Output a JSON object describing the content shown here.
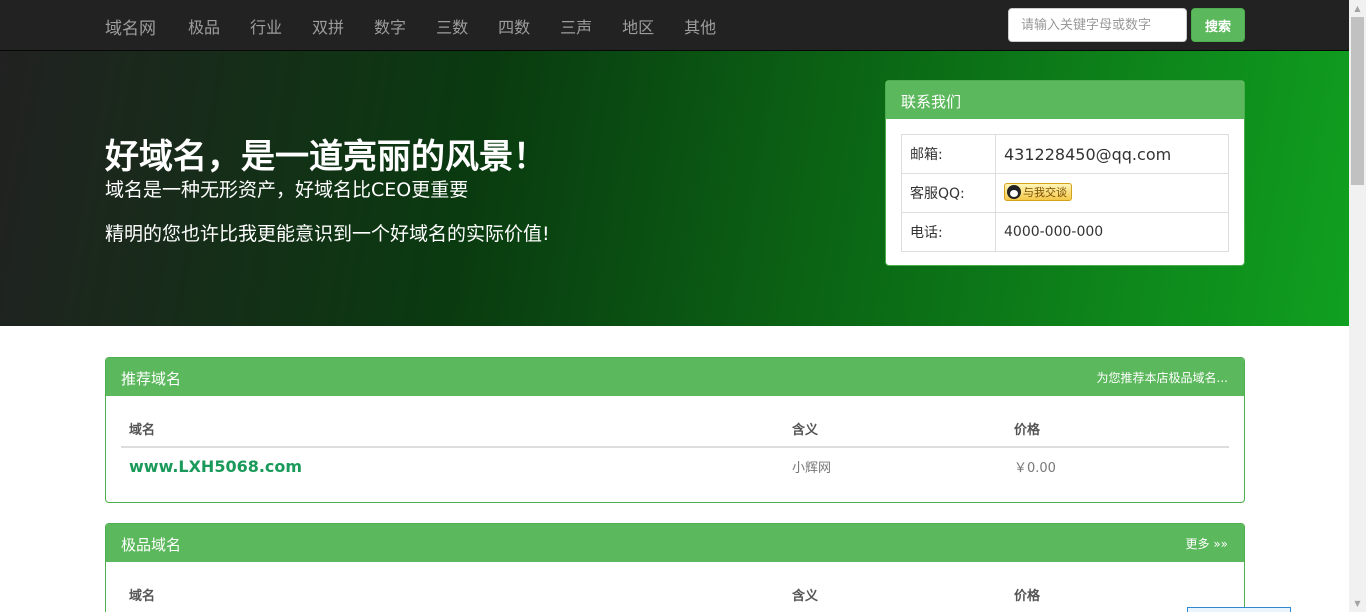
{
  "nav": {
    "brand": "域名网",
    "links": [
      "极品",
      "行业",
      "双拼",
      "数字",
      "三数",
      "四数",
      "三声",
      "地区",
      "其他"
    ],
    "search_placeholder": "请输入关键字母或数字",
    "search_button": "搜索"
  },
  "hero": {
    "title": "好域名，是一道亮丽的风景！",
    "subtitle": "域名是一种无形资产，好域名比CEO更重要",
    "line": "精明的您也许比我更能意识到一个好域名的实际价值!"
  },
  "contact": {
    "title": "联系我们",
    "rows": [
      {
        "label": "邮箱:",
        "value": "431228450@qq.com"
      },
      {
        "label": "客服QQ:",
        "value": "与我交谈"
      },
      {
        "label": "电话:",
        "value": "4000-000-000"
      }
    ]
  },
  "recommended": {
    "title": "推荐域名",
    "right_link": "为您推荐本店极品域名...",
    "headers": [
      "域名",
      "含义",
      "价格"
    ],
    "rows": [
      {
        "domain": "www.LXH5068.com",
        "meaning": "小辉网",
        "price": "￥0.00"
      }
    ]
  },
  "premium": {
    "title": "极品域名",
    "right_link": "更多 »»",
    "headers": [
      "域名",
      "含义",
      "价格"
    ]
  },
  "colors": {
    "nav_bg": "#222222",
    "panel_green": "#5cb85c",
    "domain_link": "#1a9a5a"
  }
}
